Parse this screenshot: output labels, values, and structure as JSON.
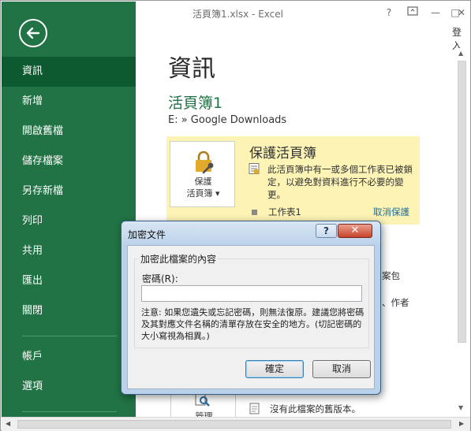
{
  "window": {
    "title": "活頁簿1.xlsx - Excel",
    "help_glyph": "?",
    "minimize_glyph": "—",
    "restore_glyph": "□",
    "close_glyph": "✕",
    "sign_in": "登入"
  },
  "sidebar": {
    "items": [
      {
        "label": "資訊",
        "active": true
      },
      {
        "label": "新增"
      },
      {
        "label": "開啟舊檔"
      },
      {
        "label": "儲存檔案"
      },
      {
        "label": "另存新檔"
      },
      {
        "label": "列印"
      },
      {
        "label": "共用"
      },
      {
        "label": "匯出"
      },
      {
        "label": "關閉"
      }
    ],
    "bottom_items": [
      {
        "label": "帳戶"
      },
      {
        "label": "選項"
      }
    ]
  },
  "info": {
    "page_title": "資訊",
    "workbook_name": "活頁簿1",
    "path": "E: » Google Downloads",
    "protect": {
      "button_label_line1": "保護",
      "button_label_line2": "活頁簿 ▾",
      "title": "保護活頁簿",
      "description": "此活頁簿中有一或多個工作表已被鎖定，以避免對資料進行不必要的變更。",
      "sheet_name": "工作表1",
      "unprotect_link": "取消保護"
    },
    "partial_text_1": "案包",
    "partial_text_2": "、作者",
    "manage_label": "管理",
    "no_versions": "沒有此檔案的舊版本。"
  },
  "dialog": {
    "title": "加密文件",
    "help_glyph": "?",
    "close_glyph": "✕",
    "group_title": "加密此檔案的內容",
    "password_label": "密碼(R):",
    "password_value": "",
    "note": "注意: 如果您遺失或忘記密碼，則無法復原。建議您將密碼及其對應文件名稱的清單存放在安全的地方。(切記密碼的大小寫視為相異。)",
    "ok_label": "確定",
    "cancel_label": "取消"
  },
  "colors": {
    "excel_green": "#217346",
    "active_nav": "#0d5a31",
    "protect_highlight": "#fcf3b5",
    "link_blue": "#1e6e9c"
  },
  "icons": {
    "back": "back-arrow-icon",
    "lock": "lock-key-icon",
    "document": "document-icon",
    "manage": "manage-versions-icon"
  }
}
